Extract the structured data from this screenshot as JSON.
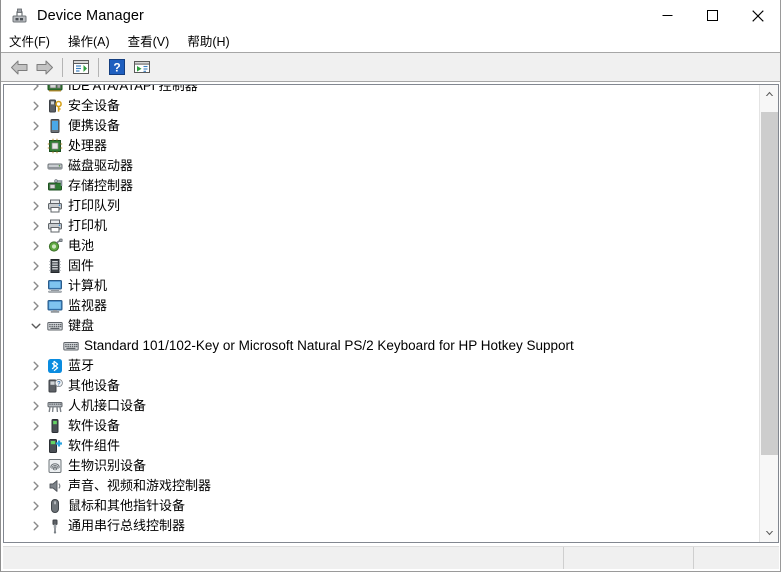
{
  "window": {
    "title": "Device Manager",
    "title_icon": "device-manager-icon",
    "minimize_label": "─",
    "maximize_label": "□",
    "close_label": "✕"
  },
  "menubar": {
    "items": [
      {
        "label": "文件(F)",
        "name": "menu-file"
      },
      {
        "label": "操作(A)",
        "name": "menu-action"
      },
      {
        "label": "查看(V)",
        "name": "menu-view"
      },
      {
        "label": "帮助(H)",
        "name": "menu-help"
      }
    ]
  },
  "toolbar": {
    "buttons": [
      {
        "name": "back-button",
        "icon": "back-arrow-icon"
      },
      {
        "name": "forward-button",
        "icon": "forward-arrow-icon"
      },
      {
        "name": "properties-button",
        "icon": "properties-icon"
      },
      {
        "name": "help-button",
        "icon": "help-question-icon"
      },
      {
        "name": "scan-hardware-changes-button",
        "icon": "scan-hardware-icon"
      }
    ]
  },
  "tree": {
    "rows": [
      {
        "label": "IDE ATA/ATAPI 控制器",
        "icon": "ide-controller-icon",
        "expanded": false,
        "level": 0,
        "latin": false
      },
      {
        "label": "安全设备",
        "icon": "security-device-icon",
        "expanded": false,
        "level": 0,
        "latin": false
      },
      {
        "label": "便携设备",
        "icon": "portable-device-icon",
        "expanded": false,
        "level": 0,
        "latin": false
      },
      {
        "label": "处理器",
        "icon": "processor-icon",
        "expanded": false,
        "level": 0,
        "latin": false
      },
      {
        "label": "磁盘驱动器",
        "icon": "disk-drive-icon",
        "expanded": false,
        "level": 0,
        "latin": false
      },
      {
        "label": "存储控制器",
        "icon": "storage-controller-icon",
        "expanded": false,
        "level": 0,
        "latin": false
      },
      {
        "label": "打印队列",
        "icon": "print-queue-icon",
        "expanded": false,
        "level": 0,
        "latin": false
      },
      {
        "label": "打印机",
        "icon": "printer-icon",
        "expanded": false,
        "level": 0,
        "latin": false
      },
      {
        "label": "电池",
        "icon": "battery-icon",
        "expanded": false,
        "level": 0,
        "latin": false
      },
      {
        "label": "固件",
        "icon": "firmware-icon",
        "expanded": false,
        "level": 0,
        "latin": false
      },
      {
        "label": "计算机",
        "icon": "computer-icon",
        "expanded": false,
        "level": 0,
        "latin": false
      },
      {
        "label": "监视器",
        "icon": "monitor-icon",
        "expanded": false,
        "level": 0,
        "latin": false
      },
      {
        "label": "键盘",
        "icon": "keyboard-icon",
        "expanded": true,
        "level": 0,
        "latin": false
      },
      {
        "label": "Standard 101/102-Key or Microsoft Natural PS/2 Keyboard for HP Hotkey Support",
        "icon": "keyboard-icon",
        "expanded": null,
        "level": 1,
        "latin": true
      },
      {
        "label": "蓝牙",
        "icon": "bluetooth-icon",
        "expanded": false,
        "level": 0,
        "latin": false
      },
      {
        "label": "其他设备",
        "icon": "other-device-icon",
        "expanded": false,
        "level": 0,
        "latin": false
      },
      {
        "label": "人机接口设备",
        "icon": "hid-device-icon",
        "expanded": false,
        "level": 0,
        "latin": false
      },
      {
        "label": "软件设备",
        "icon": "software-device-icon",
        "expanded": false,
        "level": 0,
        "latin": false
      },
      {
        "label": "软件组件",
        "icon": "software-component-icon",
        "expanded": false,
        "level": 0,
        "latin": false
      },
      {
        "label": "生物识别设备",
        "icon": "biometric-device-icon",
        "expanded": false,
        "level": 0,
        "latin": false
      },
      {
        "label": "声音、视频和游戏控制器",
        "icon": "sound-video-game-icon",
        "expanded": false,
        "level": 0,
        "latin": false
      },
      {
        "label": "鼠标和其他指针设备",
        "icon": "mouse-icon",
        "expanded": false,
        "level": 0,
        "latin": false
      },
      {
        "label": "通用串行总线控制器",
        "icon": "usb-controller-icon",
        "expanded": false,
        "level": 0,
        "latin": false
      }
    ]
  },
  "scrollbar": {
    "up_arrow": "scroll-up-arrow-icon",
    "down_arrow": "scroll-down-arrow-icon"
  },
  "statusbar": {
    "main": "",
    "mid": "",
    "end": ""
  },
  "colors": {
    "toolbar_bg": "#f0f0f0",
    "statusbar_bg": "#f0f0f0",
    "help_blue": "#1f5fbf",
    "bluetooth_blue": "#0a8ce0",
    "scrollbar_thumb": "#cdcdcd"
  }
}
